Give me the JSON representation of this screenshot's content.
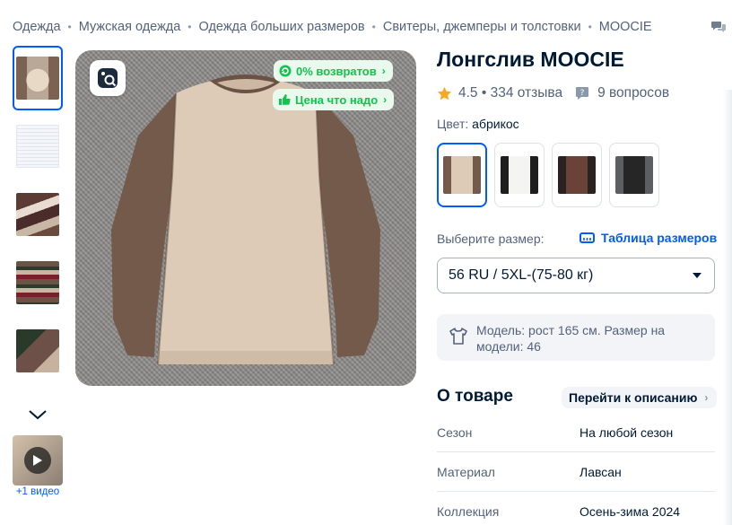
{
  "breadcrumb": {
    "items": [
      "Одежда",
      "Мужская одежда",
      "Одежда больших размеров",
      "Свитеры, джемперы и толстовки",
      "MOOCIE"
    ],
    "separator": "•"
  },
  "icons": {
    "share": "chat-bubbles-icon",
    "lens": "image-search-icon",
    "returns": "refresh-icon",
    "price": "thumbs-up-icon",
    "star": "star-icon",
    "question": "question-bubble-icon",
    "ruler": "ruler-icon",
    "tshirt": "tshirt-icon",
    "play": "play-icon",
    "chevron_down": "chevron-down-icon"
  },
  "gallery": {
    "thumbnails": [
      "photo-1",
      "photo-2",
      "photo-3",
      "photo-4",
      "photo-5"
    ],
    "video_label": "+1 видео"
  },
  "badges": {
    "returns": "0% возвратов",
    "price": "Цена что надо"
  },
  "product": {
    "title": "Лонгслив MOOCIE",
    "rating": "4.5 • 334 отзыва",
    "questions": "9 вопросов",
    "color_label": "Цвет:",
    "color_value": "абрикос"
  },
  "swatches": [
    "абрикос",
    "белый",
    "коричневый",
    "черный"
  ],
  "size": {
    "label": "Выберите размер:",
    "table_link": "Таблица размеров",
    "selected": "56 RU / 5XL-(75-80 кг)"
  },
  "model_info": "Модель: рост 165 см. Размер на модели: 46",
  "about": {
    "title": "О товаре",
    "link": "Перейти к описанию",
    "specs": [
      {
        "key": "Сезон",
        "value": "На любой сезон"
      },
      {
        "key": "Материал",
        "value": "Лавсан"
      },
      {
        "key": "Коллекция",
        "value": "Осень-зима 2024"
      }
    ]
  },
  "colors": {
    "accent": "#005bff",
    "badge_green": "#10c44c",
    "badge_bg": "#e9f9ee",
    "star": "#f9a825",
    "text_primary": "#001a34",
    "text_secondary": "#53627a"
  }
}
